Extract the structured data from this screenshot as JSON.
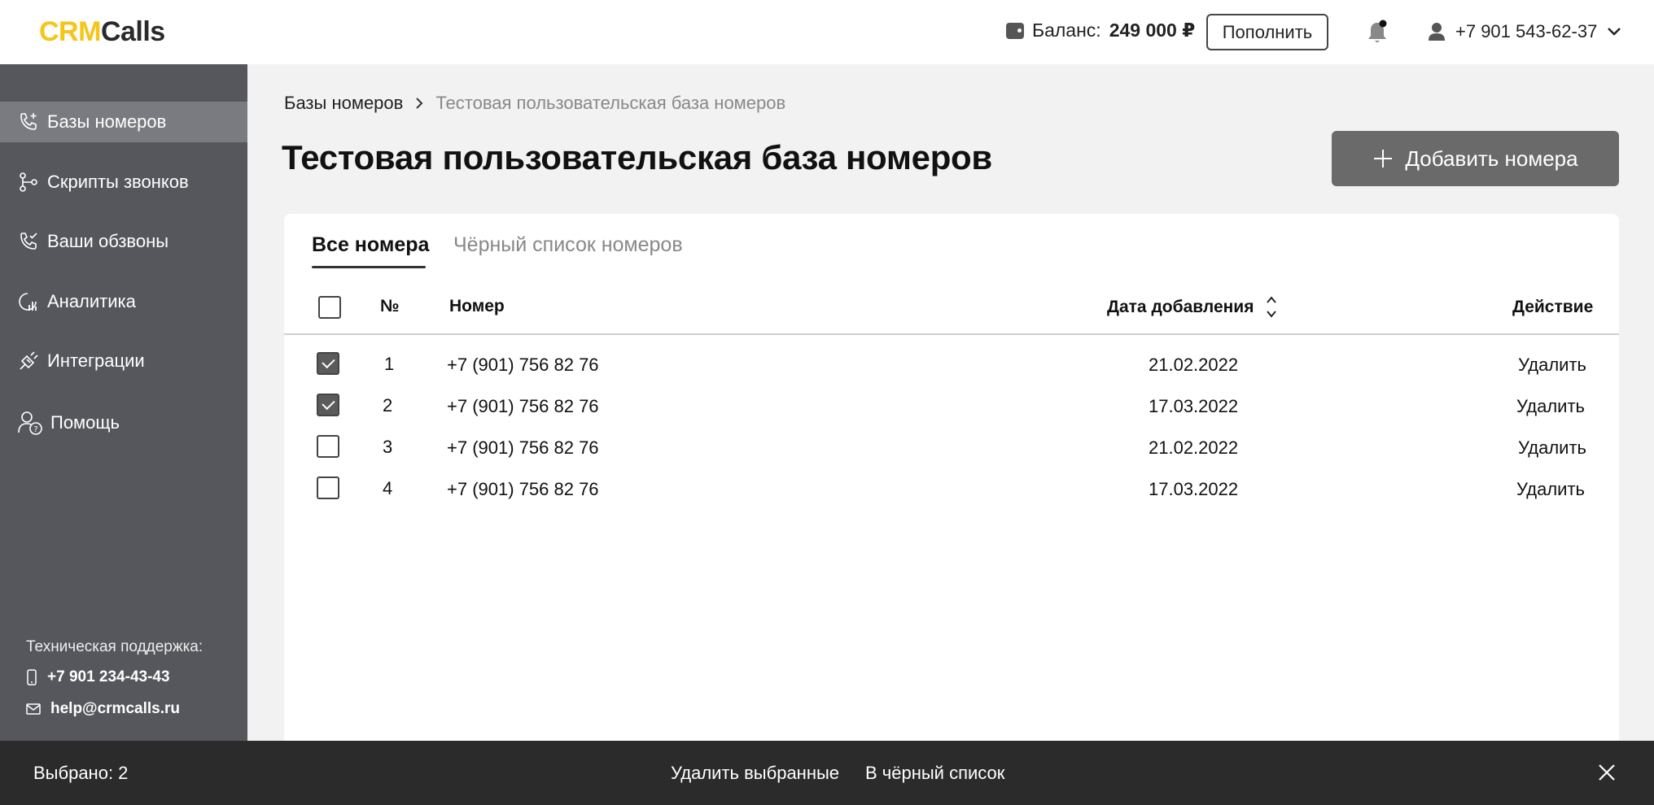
{
  "header": {
    "logo_part1": "CRM",
    "logo_part2": "Calls",
    "balance_label": "Баланс:",
    "balance_amount": "249 000 ₽",
    "topup_label": "Пополнить",
    "user_phone": "+7 901 543-62-37"
  },
  "sidebar": {
    "items": [
      {
        "label": "Базы номеров",
        "icon": "phone-plus-icon"
      },
      {
        "label": "Скрипты звонков",
        "icon": "flow-icon"
      },
      {
        "label": "Ваши обзвоны",
        "icon": "phone-check-icon"
      },
      {
        "label": "Аналитика",
        "icon": "analytics-icon"
      },
      {
        "label": "Интеграции",
        "icon": "plug-icon"
      },
      {
        "label": "Помощь",
        "icon": "user-help-icon"
      }
    ],
    "support_title": "Техническая поддержка:",
    "support_phone": "+7 901 234-43-43",
    "support_email": "help@crmcalls.ru"
  },
  "breadcrumb": {
    "parent": "Базы номеров",
    "current": "Тестовая пользовательская база номеров"
  },
  "page": {
    "title": "Тестовая пользовательская база номеров",
    "add_button": "Добавить номера"
  },
  "tabs": {
    "all": "Все номера",
    "blacklist": "Чёрный список номеров"
  },
  "table": {
    "headers": {
      "num": "№",
      "number": "Номер",
      "date": "Дата добавления",
      "action": "Действие"
    },
    "rows": [
      {
        "num": "1",
        "number": "+7 (901) 756 82 76",
        "date": "21.02.2022",
        "action": "Удалить",
        "checked": true
      },
      {
        "num": "2",
        "number": "+7 (901) 756 82 76",
        "date": "17.03.2022",
        "action": "Удалить",
        "checked": true
      },
      {
        "num": "3",
        "number": "+7 (901) 756 82 76",
        "date": "21.02.2022",
        "action": "Удалить",
        "checked": false
      },
      {
        "num": "4",
        "number": "+7 (901) 756 82 76",
        "date": "17.03.2022",
        "action": "Удалить",
        "checked": false
      }
    ]
  },
  "action_bar": {
    "selected": "Выбрано: 2",
    "delete_selected": "Удалить выбранные",
    "to_blacklist": "В чёрный список"
  },
  "colors": {
    "brand_yellow": "#f5c518",
    "sidebar_bg": "#56575c",
    "sidebar_active": "#7a7b80",
    "action_bar_bg": "#2b2b2b"
  }
}
